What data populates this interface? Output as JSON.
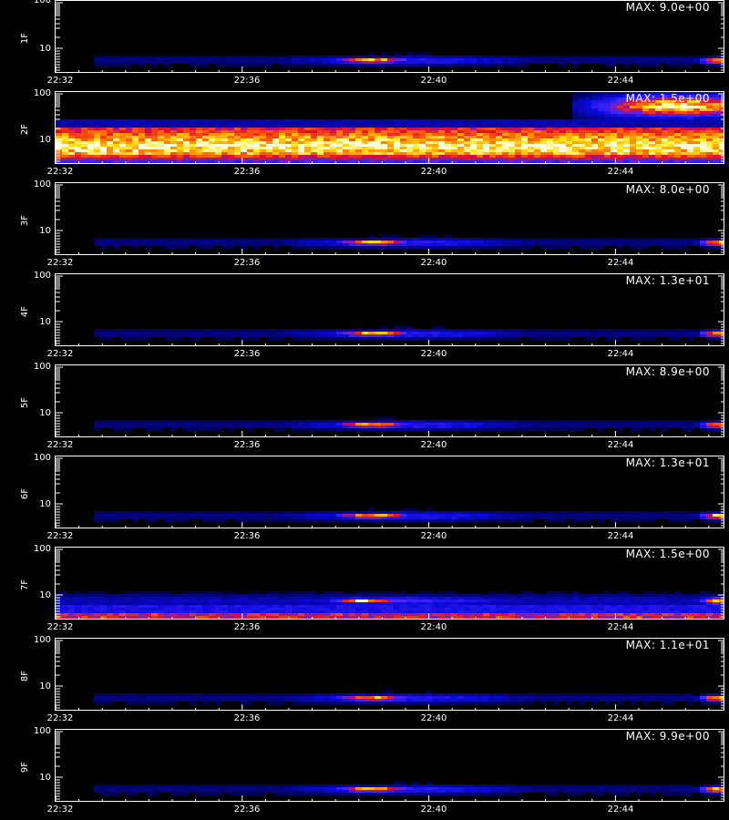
{
  "chart_data": {
    "type": "heatmap",
    "x_ticks": [
      "22:32",
      "22:36",
      "22:40",
      "22:44"
    ],
    "y_ticks": [
      "100",
      "10"
    ],
    "colormap": [
      "#000000",
      "#1010c0",
      "#3030ff",
      "#c00000",
      "#ff3000",
      "#ffd000",
      "#ffffff"
    ],
    "panels": [
      {
        "label": "1F",
        "max": "MAX: 9.0e+00",
        "type": "burst",
        "y_ticks": [
          "10",
          "100"
        ]
      },
      {
        "label": "2F",
        "max": "MAX: 1.5e+00",
        "type": "band",
        "y_ticks": [
          "100",
          "10"
        ]
      },
      {
        "label": "3F",
        "max": "MAX: 8.0e+00",
        "type": "burst",
        "y_ticks": [
          "100",
          "10"
        ]
      },
      {
        "label": "4F",
        "max": "MAX: 1.3e+01",
        "type": "burst",
        "y_ticks": [
          "100",
          "10"
        ]
      },
      {
        "label": "5F",
        "max": "MAX: 8.9e+00",
        "type": "burst",
        "y_ticks": [
          "100",
          "10"
        ]
      },
      {
        "label": "6F",
        "max": "MAX: 1.3e+01",
        "type": "burst",
        "y_ticks": [
          "100",
          "10"
        ]
      },
      {
        "label": "7F",
        "max": "MAX: 1.5e+00",
        "type": "noisy",
        "y_ticks": [
          "100",
          "10"
        ]
      },
      {
        "label": "8F",
        "max": "MAX: 1.1e+01",
        "type": "burst",
        "y_ticks": [
          "100",
          "10"
        ]
      },
      {
        "label": "9F",
        "max": "MAX: 9.9e+00",
        "type": "burst",
        "y_ticks": [
          "100",
          "10"
        ]
      }
    ]
  }
}
